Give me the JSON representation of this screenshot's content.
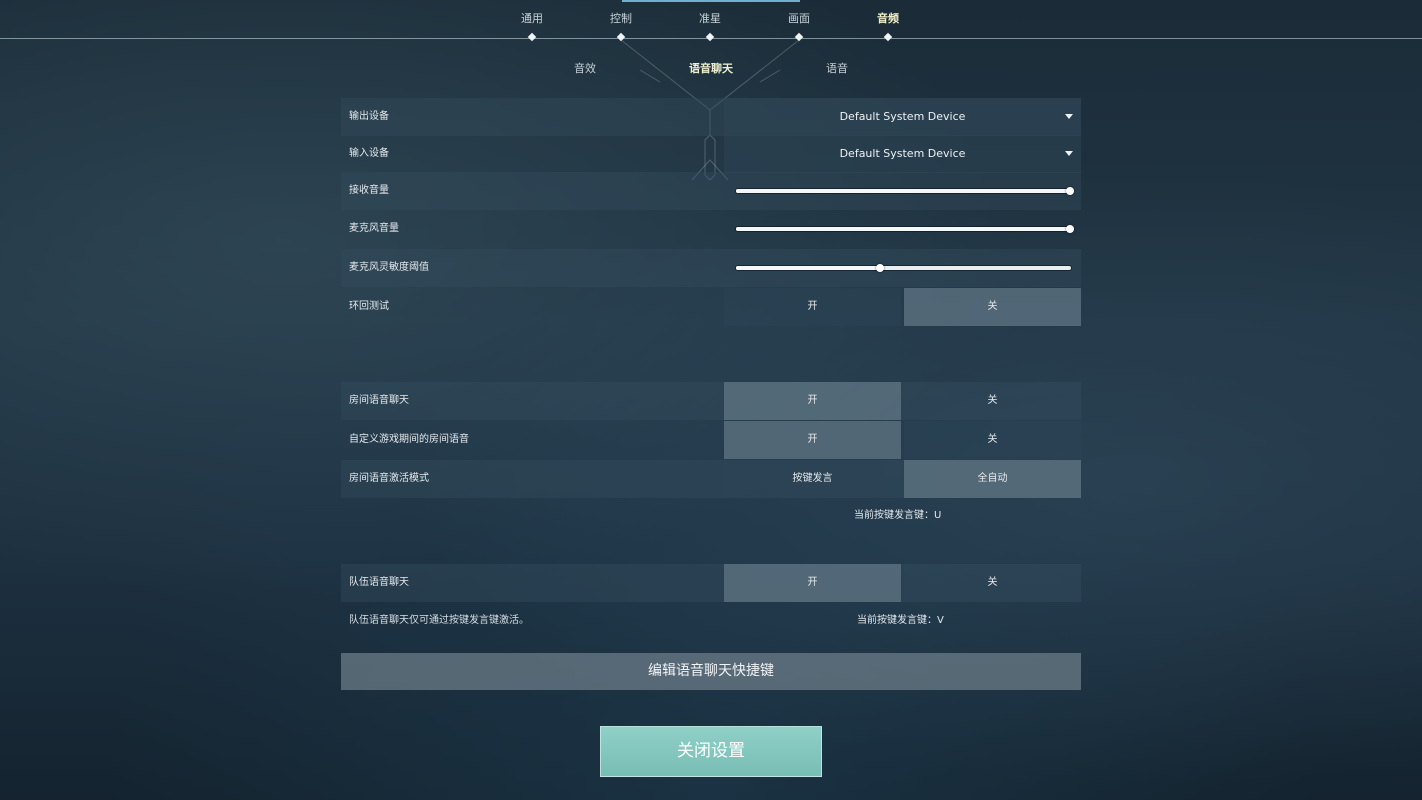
{
  "nav": {
    "tabs": [
      {
        "label": "通用"
      },
      {
        "label": "控制"
      },
      {
        "label": "准星"
      },
      {
        "label": "画面"
      },
      {
        "label": "音频"
      }
    ],
    "active_tab": "音频"
  },
  "subnav": {
    "tabs": [
      {
        "label": "音效"
      },
      {
        "label": "语音聊天"
      },
      {
        "label": "语音"
      }
    ],
    "active_tab": "语音聊天"
  },
  "settings": {
    "output_device": {
      "label": "输出设备",
      "value": "Default System Device"
    },
    "input_device": {
      "label": "输入设备",
      "value": "Default System Device"
    },
    "incoming_volume": {
      "label": "接收音量",
      "value": 1.0
    },
    "mic_volume": {
      "label": "麦克风音量",
      "value": 1.0
    },
    "mic_threshold": {
      "label": "麦克风灵敏度阈值",
      "value": 0.43
    },
    "loopback_test": {
      "label": "环回测试",
      "on_label": "开",
      "off_label": "关",
      "selected": "关"
    },
    "party_voice": {
      "label": "房间语音聊天",
      "on_label": "开",
      "off_label": "关",
      "selected": "开"
    },
    "party_custom": {
      "label": "自定义游戏期间的房间语音",
      "on_label": "开",
      "off_label": "关",
      "selected": "开"
    },
    "party_activation": {
      "label": "房间语音激活模式",
      "opt_a": "按键发言",
      "opt_b": "全自动",
      "selected": "全自动"
    },
    "party_key_info": "当前按键发言键：U",
    "team_voice": {
      "label": "队伍语音聊天",
      "on_label": "开",
      "off_label": "关",
      "selected": "开"
    },
    "team_note": "队伍语音聊天仅可通过按键发言键激活。",
    "team_key_info": "当前按键发言键：V"
  },
  "buttons": {
    "edit_keybinds": "编辑语音聊天快捷键",
    "close_settings": "关闭设置"
  }
}
